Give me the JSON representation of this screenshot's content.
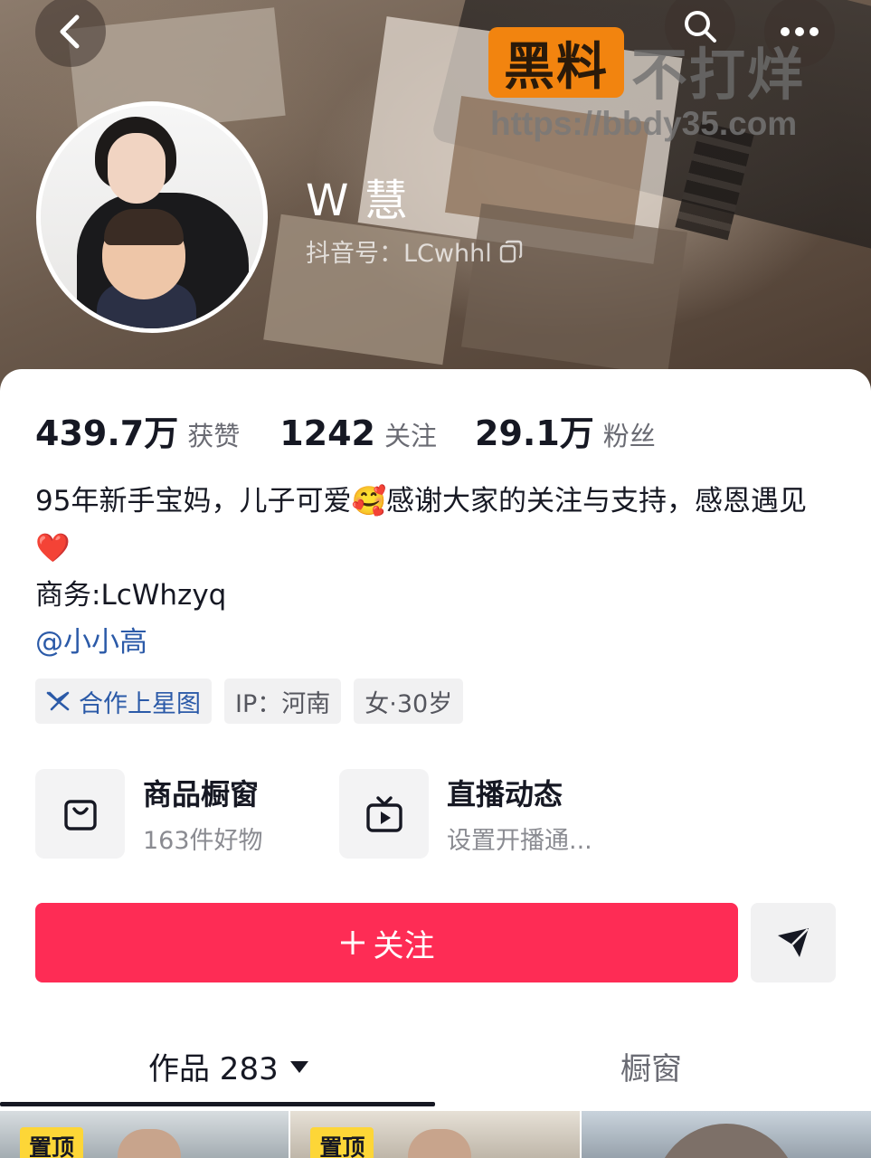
{
  "header": {
    "nickname": "W 慧",
    "douyin_id": "抖音号：LCwhhl",
    "icons": [
      "back-arrow-icon",
      "search-icon",
      "more-dots-icon",
      "copy-icon"
    ]
  },
  "watermark": {
    "badge": "黑料",
    "text": "不打烊",
    "url": "https://bbdy35.com"
  },
  "stats": [
    {
      "value": "439.7万",
      "label": "获赞"
    },
    {
      "value": "1242",
      "label": "关注"
    },
    {
      "value": "29.1万",
      "label": "粉丝"
    }
  ],
  "bio": {
    "line1": "95年新手宝妈，儿子可爱🥰感谢大家的关注与支持，感恩遇见❤️",
    "line2": "商务:LcWhzyq",
    "mention": "@小小高"
  },
  "tags": {
    "star": "合作上星图",
    "ip": "IP：河南",
    "gender_age": "女·30岁"
  },
  "services": {
    "shop_title": "商品橱窗",
    "shop_sub": "163件好物",
    "live_title": "直播动态",
    "live_sub": "设置开播通..."
  },
  "actions": {
    "follow_label": "关注"
  },
  "tabs": {
    "works_label": "作品 283",
    "window_label": "橱窗"
  },
  "thumbnails": {
    "pin_label": "置顶"
  },
  "colors": {
    "follow": "#fe2c55",
    "mention": "#2b5aa8",
    "pin": "#fdd637",
    "watermark_badge": "#f2840f"
  }
}
